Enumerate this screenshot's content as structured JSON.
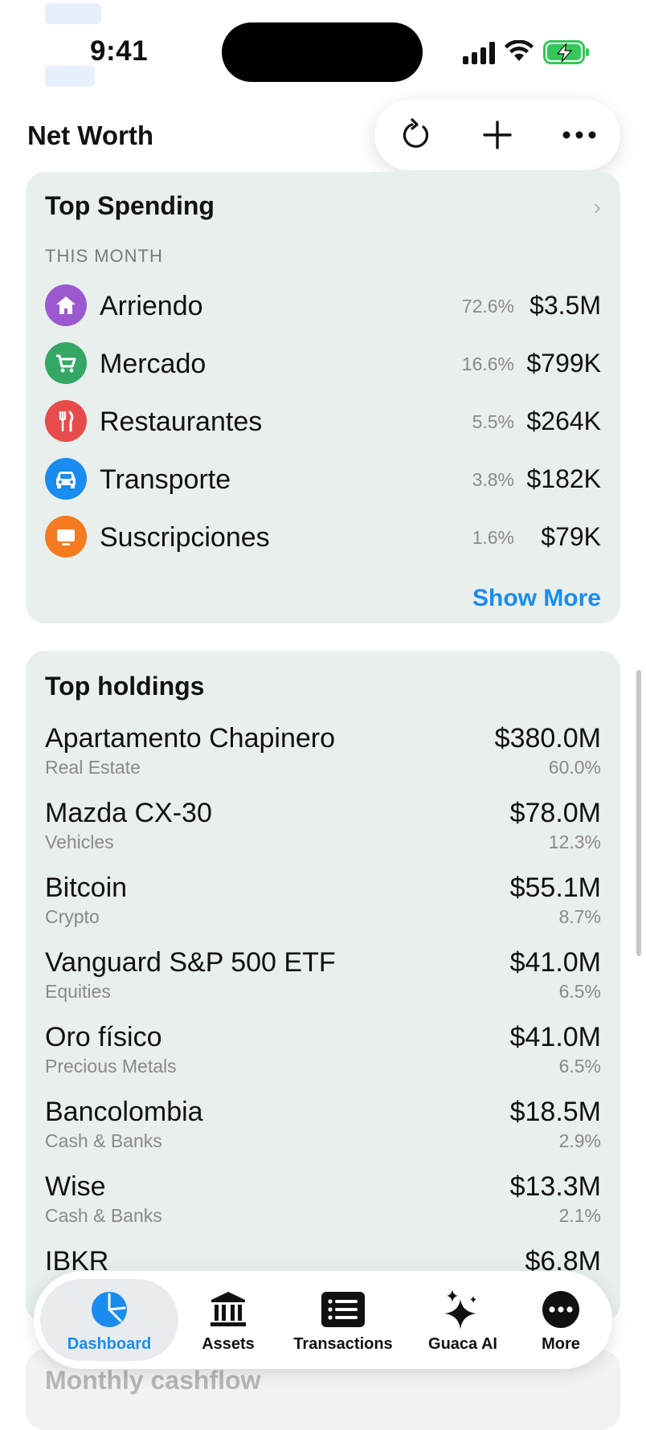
{
  "status_bar": {
    "time": "9:41"
  },
  "header": {
    "title": "Net Worth"
  },
  "toolbar": {
    "refresh_icon": "refresh-icon",
    "add_icon": "plus-icon",
    "more_icon": "ellipsis-icon"
  },
  "top_spending": {
    "title": "Top Spending",
    "period": "THIS MONTH",
    "show_more": "Show More",
    "items": [
      {
        "name": "Arriendo",
        "pct": "72.6%",
        "amount": "$3.5M",
        "color": "#9b59d0",
        "icon": "house-icon"
      },
      {
        "name": "Mercado",
        "pct": "16.6%",
        "amount": "$799K",
        "color": "#34a765",
        "icon": "cart-icon"
      },
      {
        "name": "Restaurantes",
        "pct": "5.5%",
        "amount": "$264K",
        "color": "#e74c4c",
        "icon": "fork-knife-icon"
      },
      {
        "name": "Transporte",
        "pct": "3.8%",
        "amount": "$182K",
        "color": "#1a8cf0",
        "icon": "car-icon"
      },
      {
        "name": "Suscripciones",
        "pct": "1.6%",
        "amount": "$79K",
        "color": "#f47b20",
        "icon": "tv-icon"
      }
    ]
  },
  "top_holdings": {
    "title": "Top holdings",
    "items": [
      {
        "name": "Apartamento Chapinero",
        "category": "Real Estate",
        "value": "$380.0M",
        "pct": "60.0%"
      },
      {
        "name": "Mazda CX-30",
        "category": "Vehicles",
        "value": "$78.0M",
        "pct": "12.3%"
      },
      {
        "name": "Bitcoin",
        "category": "Crypto",
        "value": "$55.1M",
        "pct": "8.7%"
      },
      {
        "name": "Vanguard S&P 500 ETF",
        "category": "Equities",
        "value": "$41.0M",
        "pct": "6.5%"
      },
      {
        "name": "Oro físico",
        "category": "Precious Metals",
        "value": "$41.0M",
        "pct": "6.5%"
      },
      {
        "name": "Bancolombia",
        "category": "Cash & Banks",
        "value": "$18.5M",
        "pct": "2.9%"
      },
      {
        "name": "Wise",
        "category": "Cash & Banks",
        "value": "$13.3M",
        "pct": "2.1%"
      },
      {
        "name": "IBKR",
        "category": "",
        "value": "$6.8M",
        "pct": ""
      }
    ]
  },
  "next_section": {
    "title": "Monthly cashflow"
  },
  "tabbar": {
    "tabs": [
      {
        "label": "Dashboard",
        "icon": "pie-chart-icon",
        "active": true
      },
      {
        "label": "Assets",
        "icon": "bank-icon",
        "active": false
      },
      {
        "label": "Transactions",
        "icon": "list-icon",
        "active": false
      },
      {
        "label": "Guaca AI",
        "icon": "sparkles-icon",
        "active": false
      },
      {
        "label": "More",
        "icon": "ellipsis-circle-icon",
        "active": false
      }
    ]
  },
  "colors": {
    "accent": "#1a8cf0",
    "card_bg": "#e8efec",
    "battery_green": "#34c759"
  }
}
